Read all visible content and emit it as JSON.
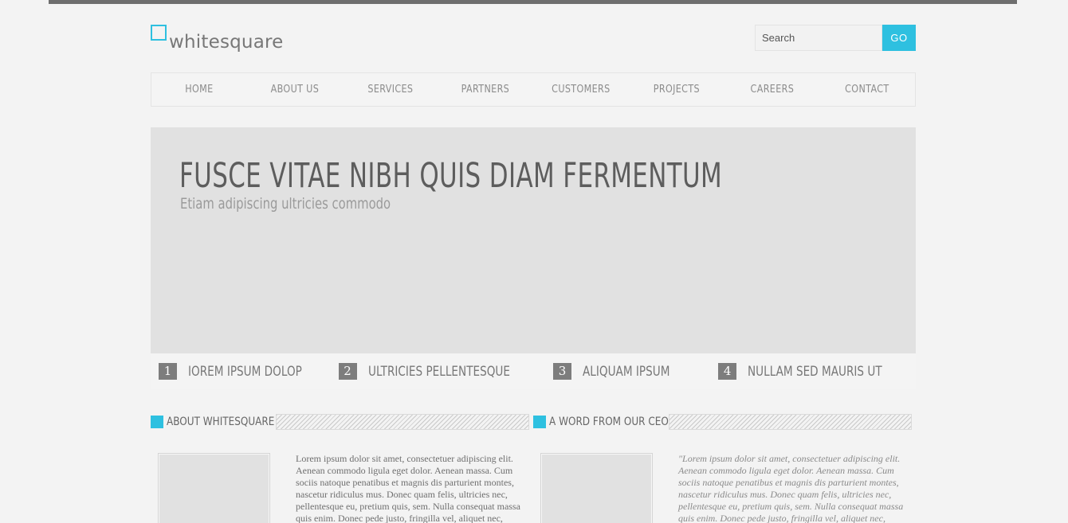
{
  "brand": {
    "name": "whitesquare",
    "accent": "#2ec0e0"
  },
  "search": {
    "placeholder": "Search",
    "button_label": "GO"
  },
  "nav": {
    "items": [
      "HOME",
      "ABOUT US",
      "SERVICES",
      "PARTNERS",
      "CUSTOMERS",
      "PROJECTS",
      "CAREERS",
      "CONTACT"
    ]
  },
  "hero": {
    "title": "FUSCE VITAE NIBH QUIS DIAM FERMENTUM",
    "subtitle": "Etiam adipiscing ultricies commodo"
  },
  "slides": [
    {
      "num": "1",
      "label": "IOREM IPSUM DOLOP"
    },
    {
      "num": "2",
      "label": "ULTRICIES PELLENTESQUE"
    },
    {
      "num": "3",
      "label": "ALIQUAM IPSUM"
    },
    {
      "num": "4",
      "label": "NULLAM SED MAURIS UT"
    }
  ],
  "sections": {
    "about": {
      "title": "ABOUT WHITESQUARE",
      "text": "Lorem ipsum dolor sit amet, consectetuer adipiscing elit. Aenean commodo ligula eget dolor. Aenean massa. Cum sociis natoque penatibus et magnis dis parturient montes, nascetur ridiculus mus. Donec quam felis, ultricies nec, pellentesque eu, pretium quis, sem. Nulla consequat massa quis enim. Donec pede justo, fringilla vel, aliquet nec,"
    },
    "ceo": {
      "title": "A WORD FROM OUR CEO",
      "text": "\"Lorem ipsum dolor sit amet, consectetuer adipiscing elit. Aenean commodo ligula eget dolor. Aenean massa. Cum sociis natoque penatibus et magnis dis parturient montes, nascetur ridiculus mus. Donec quam felis, ultricies nec, pellentesque eu, pretium quis, sem. Nulla consequat massa quis enim. Donec pede justo, fringilla vel, aliquet nec,"
    }
  }
}
